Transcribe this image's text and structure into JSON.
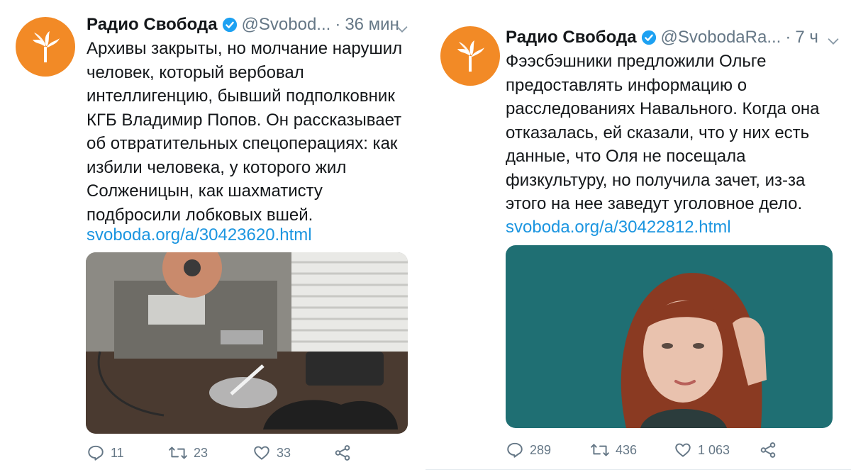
{
  "tweets": [
    {
      "name": "Радио Свобода",
      "handle": "@Svobod...",
      "separator": "·",
      "time": "36 мин",
      "text": "Архивы закрыты, но молчание нарушил\nчеловек, который вербовал\nинтеллигенцию, бывший подполковник\nКГБ Владимир Попов. Он рассказывает\nоб  отвратительных спецоперациях: как\nизбили человека, у которого жил\nСолженицын, как шахматисту\nподбросили лобковых вшей.",
      "link": "svoboda.org/a/30423620.html",
      "replies": "11",
      "retweets": "23",
      "likes": "33"
    },
    {
      "name": "Радио Свобода",
      "handle": "@SvobodaRa...",
      "separator": "·",
      "time": "7 ч",
      "text": "Фээсбэшники предложили Ольге\nпредоставлять информацию о\nрасследованиях Навального. Когда она\nотказалась, ей сказали, что у них есть\nданные, что Оля не посещала\nфизкультуру, но получила зачет, из-за\nэтого на нее заведут уголовное дело.",
      "link": "svoboda.org/a/30422812.html",
      "replies": "289",
      "retweets": "436",
      "likes": "1 063"
    }
  ],
  "colors": {
    "avatar": "#f28a26",
    "verified": "#1da1f2",
    "link": "#1b95e0",
    "meta": "#657786"
  },
  "icons": [
    "radio-svoboda-logo",
    "verified-badge-icon",
    "caret-down-icon",
    "reply-icon",
    "retweet-icon",
    "like-icon",
    "share-icon"
  ]
}
